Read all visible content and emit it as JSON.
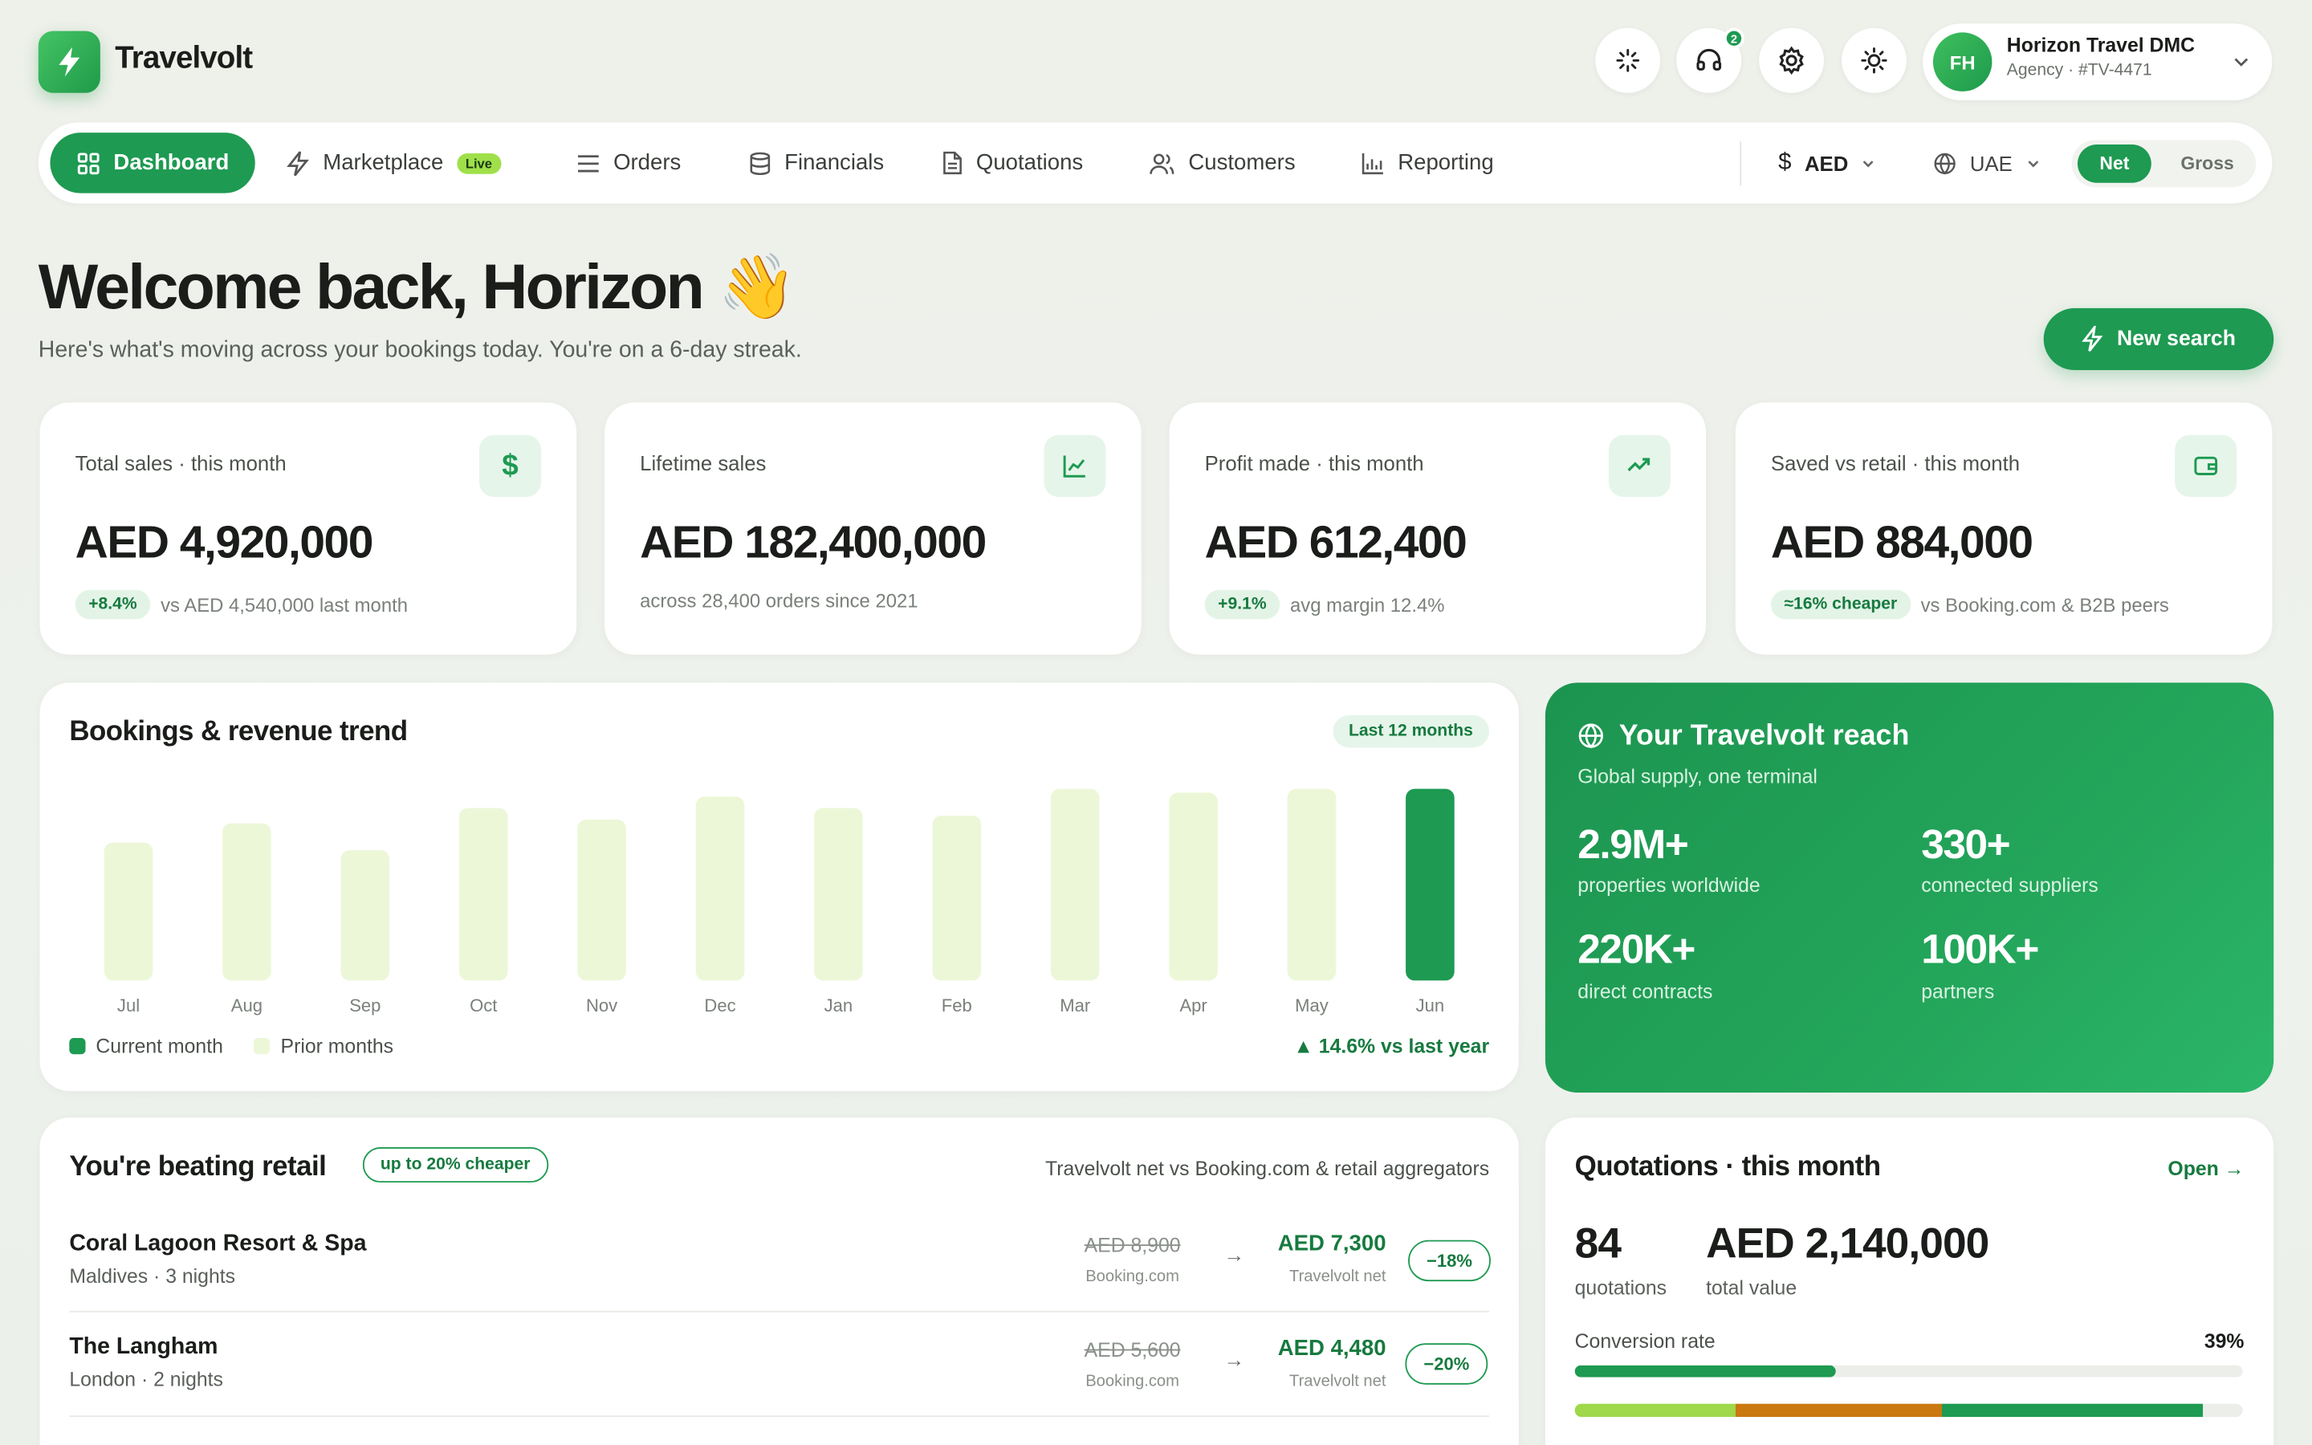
{
  "brand": {
    "name": "Travelvolt"
  },
  "header": {
    "notif_count": "2",
    "user": {
      "initials": "FH",
      "name": "Horizon Travel DMC",
      "sub": "Agency · #TV-4471"
    }
  },
  "nav": {
    "items": [
      {
        "label": "Dashboard"
      },
      {
        "label": "Marketplace",
        "badge": "Live"
      },
      {
        "label": "Orders"
      },
      {
        "label": "Financials"
      },
      {
        "label": "Quotations"
      },
      {
        "label": "Customers"
      },
      {
        "label": "Reporting"
      }
    ],
    "currency": "AED",
    "region": "UAE",
    "toggle": {
      "on": "Net",
      "off": "Gross"
    }
  },
  "welcome": {
    "title": "Welcome back, Horizon 👋",
    "subtitle": "Here's what's moving across your bookings today. You're on a 6-day streak.",
    "cta": "New search"
  },
  "kpis": [
    {
      "label": "Total sales · this month",
      "value": "AED 4,920,000",
      "pill": "+8.4%",
      "note": "vs AED 4,540,000 last month",
      "icon": "dollar-icon"
    },
    {
      "label": "Lifetime sales",
      "value": "AED 182,400,000",
      "pill": "",
      "note": "across 28,400 orders since 2021",
      "icon": "chart-icon"
    },
    {
      "label": "Profit made · this month",
      "value": "AED 612,400",
      "pill": "+9.1%",
      "note": "avg margin 12.4%",
      "icon": "trend-up-icon"
    },
    {
      "label": "Saved vs retail · this month",
      "value": "AED 884,000",
      "pill": "≈16% cheaper",
      "note": "vs Booking.com & B2B peers",
      "icon": "wallet-icon"
    }
  ],
  "trend": {
    "title": "Bookings & revenue trend",
    "range": "Last 12 months",
    "legend_current": "Current month",
    "legend_prior": "Prior months",
    "delta": "▲ 14.6% vs last year"
  },
  "chart_data": {
    "type": "bar",
    "categories": [
      "Jul",
      "Aug",
      "Sep",
      "Oct",
      "Nov",
      "Dec",
      "Jan",
      "Feb",
      "Mar",
      "Apr",
      "May",
      "Jun"
    ],
    "values": [
      72,
      82,
      68,
      90,
      84,
      96,
      90,
      86,
      100,
      98,
      100,
      100
    ],
    "highlight_index": 11,
    "colors": {
      "current": "#1e9a52",
      "prior": "#ecf7d8"
    }
  },
  "reach": {
    "title": "Your Travelvolt reach",
    "subtitle": "Global supply, one terminal",
    "stats": [
      {
        "value": "2.9M+",
        "label": "properties worldwide"
      },
      {
        "value": "330+",
        "label": "connected suppliers"
      },
      {
        "value": "220K+",
        "label": "direct contracts"
      },
      {
        "value": "100K+",
        "label": "partners"
      }
    ]
  },
  "retail": {
    "title": "You're beating retail",
    "tag": "up to 20% cheaper",
    "note": "Travelvolt net vs Booking.com & retail aggregators",
    "source": "Booking.com",
    "net_caption": "Travelvolt net",
    "rows": [
      {
        "name": "Coral Lagoon Resort & Spa",
        "sub": "Maldives · 3 nights",
        "retail": "AED 8,900",
        "net": "AED 7,300",
        "disc": "−18%"
      },
      {
        "name": "The Langham",
        "sub": "London · 2 nights",
        "retail": "AED 5,600",
        "net": "AED 4,480",
        "disc": "−20%"
      }
    ]
  },
  "quotations": {
    "title": "Quotations · this month",
    "open": "Open →",
    "count": "84",
    "count_label": "quotations",
    "total": "AED 2,140,000",
    "total_label": "total value",
    "conv_label": "Conversion rate",
    "conv_value": "39%",
    "conv": 0.39,
    "stack": [
      {
        "fraction": 0.24,
        "color": "#9fd84a"
      },
      {
        "fraction": 0.31,
        "color": "#c9790f"
      },
      {
        "fraction": 0.39,
        "color": "#1e9a52"
      }
    ]
  },
  "colors": {
    "accent": "#1e9a52"
  }
}
